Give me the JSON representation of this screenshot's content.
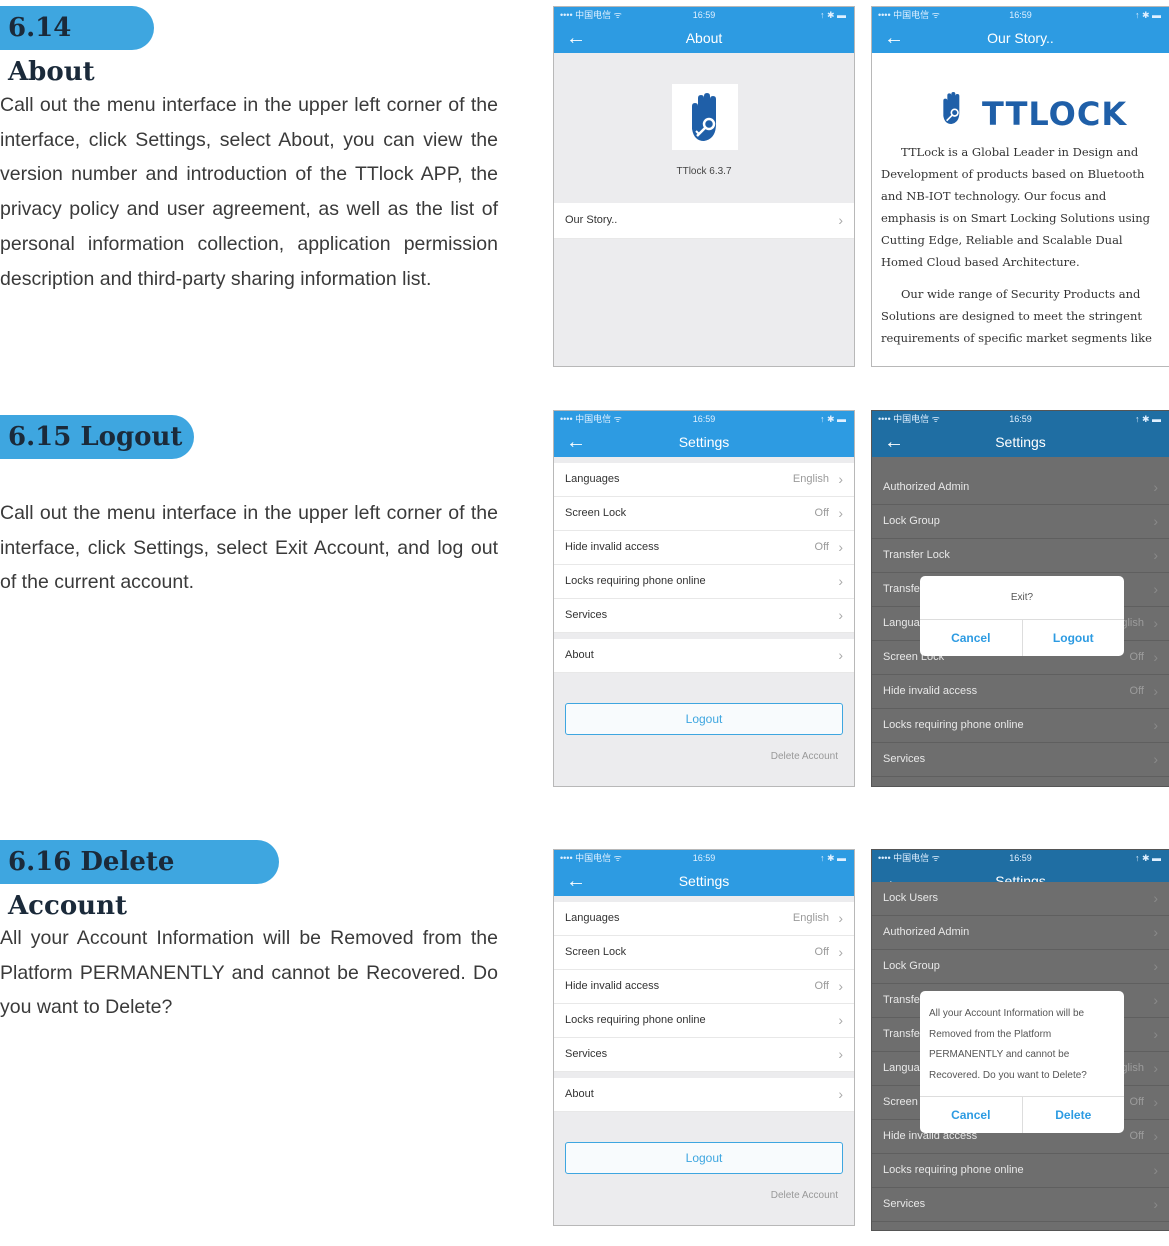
{
  "sections": [
    {
      "heading": "6.14 About",
      "body": "Call out the menu interface in the upper left corner of the interface, click Settings, select About, you can view the version number and introduction of the TTlock APP, the privacy policy and user agreement, as well as the list of personal information collection, application permission description and third-party sharing information list."
    },
    {
      "heading": "6.15 Logout",
      "body": "Call out the menu interface in the upper left corner of the interface, click Settings, select Exit Account, and log out of the current account."
    },
    {
      "heading": "6.16 Delete Account",
      "body": "All your Account Information will be Removed from the Platform PERMANENTLY and cannot be Recovered. Do you want to Delete?"
    }
  ],
  "status_bar": {
    "carrier": "•••• 中国电信 ᯤ",
    "time": "16:59",
    "icons": "↑ ✱ ▬"
  },
  "about_screen": {
    "title": "About",
    "version": "TTlock 6.3.7",
    "story_item": "Our Story..",
    "chevron": "›"
  },
  "story_screen": {
    "title": "Our Story..",
    "logo_text": "TTLOCK",
    "para1": "TTLock is a Global Leader in Design and Development of products based on Bluetooth and NB-IOT technology. Our focus and emphasis is on Smart Locking Solutions using Cutting Edge, Reliable and Scalable Dual Homed Cloud based Architecture.",
    "para2": "Our wide range of Security Products and Solutions are designed to meet the stringent requirements of specific market segments like"
  },
  "settings": {
    "title": "Settings",
    "back": "←",
    "chevron": "›",
    "rows": [
      {
        "label": "Languages",
        "value": "English"
      },
      {
        "label": "Screen Lock",
        "value": "Off"
      },
      {
        "label": "Hide invalid access",
        "value": "Off"
      },
      {
        "label": "Locks requiring phone online",
        "value": ""
      },
      {
        "label": "Services",
        "value": ""
      }
    ],
    "about": "About",
    "logout": "Logout",
    "delete_account": "Delete Account"
  },
  "dark_list1": [
    {
      "label": "Authorized Admin",
      "value": ""
    },
    {
      "label": "Lock Group",
      "value": ""
    },
    {
      "label": "Transfer Lock",
      "value": ""
    },
    {
      "label": "Transfe",
      "value": ""
    },
    {
      "label": "Langua",
      "value": "glish"
    },
    {
      "label": "Screen Lock",
      "value": "Off"
    },
    {
      "label": "Hide invalid access",
      "value": "Off"
    },
    {
      "label": "Locks requiring phone online",
      "value": ""
    },
    {
      "label": "Services",
      "value": ""
    }
  ],
  "dark_list2": [
    {
      "label": "Lock Users",
      "value": ""
    },
    {
      "label": "Authorized Admin",
      "value": ""
    },
    {
      "label": "Lock Group",
      "value": ""
    },
    {
      "label": "Transfe",
      "value": ""
    },
    {
      "label": "Transfe",
      "value": ""
    },
    {
      "label": "Langua",
      "value": "glish"
    },
    {
      "label": "Screen",
      "value": "Off"
    },
    {
      "label": "Hide invalid access",
      "value": "Off"
    },
    {
      "label": "Locks requiring phone online",
      "value": ""
    },
    {
      "label": "Services",
      "value": ""
    }
  ],
  "exit_dialog": {
    "message": "Exit?",
    "cancel": "Cancel",
    "confirm": "Logout"
  },
  "delete_dialog": {
    "message": "All your Account Information will be Removed from the Platform PERMANENTLY and cannot be Recovered. Do you want to Delete?",
    "cancel": "Cancel",
    "confirm": "Delete"
  },
  "colors": {
    "accent": "#2d9be2",
    "heading_pill": "#3ea6e0",
    "logo": "#1f5fa8"
  }
}
